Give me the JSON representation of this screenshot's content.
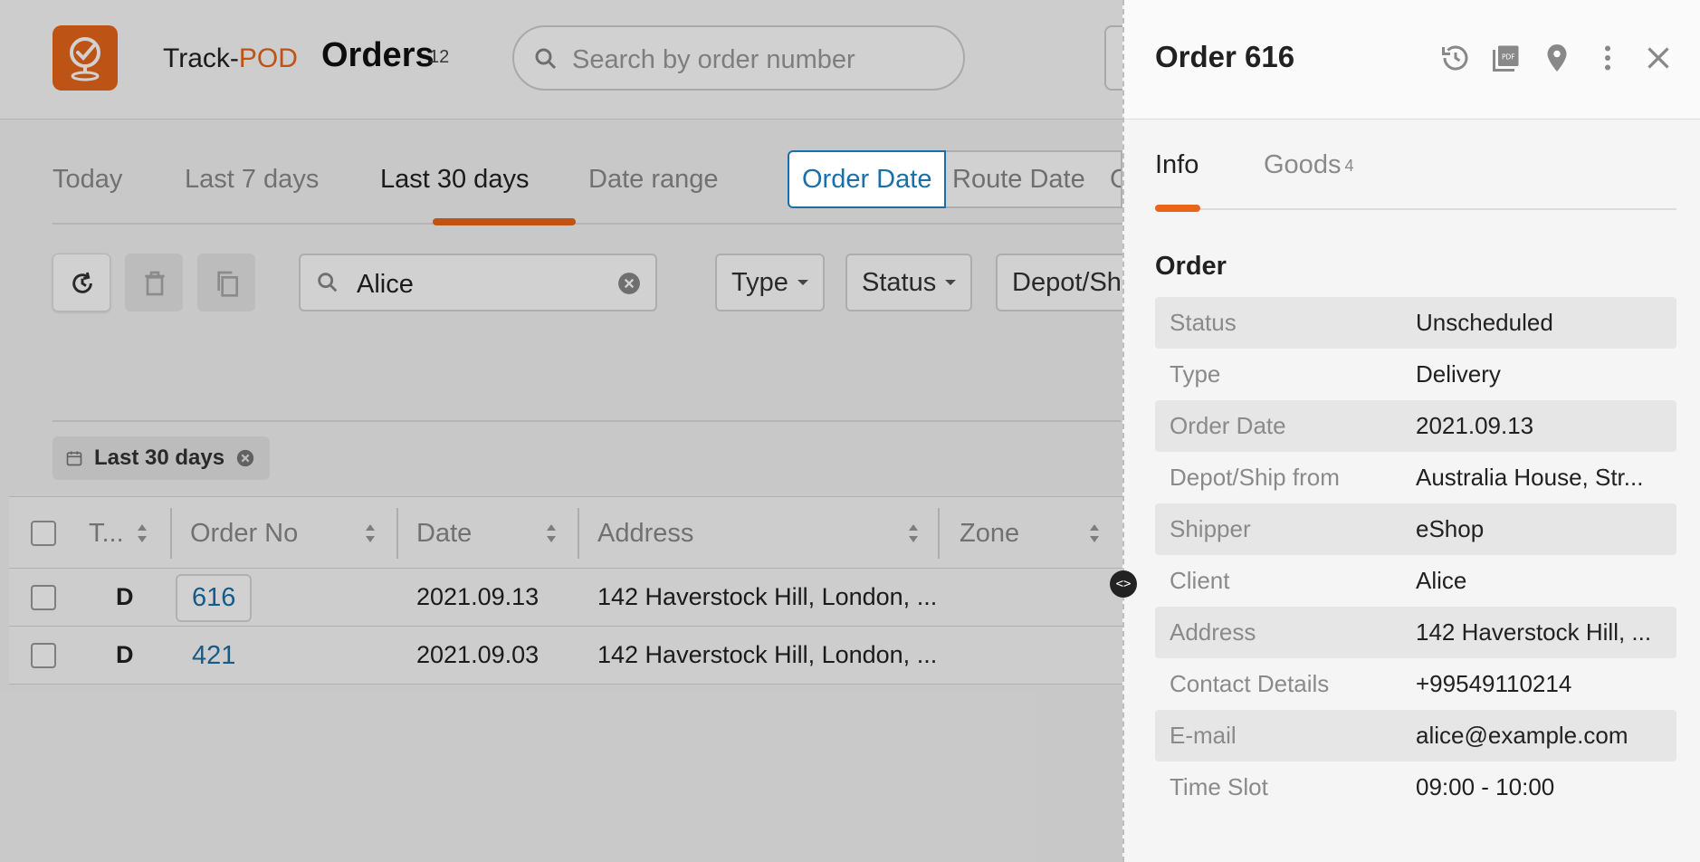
{
  "app": {
    "brand_left": "Track-",
    "brand_right": "POD",
    "page_title": "Orders",
    "order_count": "12"
  },
  "search": {
    "placeholder": "Search by order number"
  },
  "period_tabs": [
    {
      "label": "Today"
    },
    {
      "label": "Last 7 days"
    },
    {
      "label": "Last 30 days"
    },
    {
      "label": "Date range"
    }
  ],
  "date_mode": {
    "order_date": "Order Date",
    "route_date": "Route Date",
    "stub": "C"
  },
  "filters": {
    "search_value": "Alice",
    "type": "Type",
    "status": "Status",
    "depot": "Depot/Shi"
  },
  "active_chip": "Last 30 days",
  "grid": {
    "columns": [
      "T...",
      "Order No",
      "Date",
      "Address",
      "Zone"
    ],
    "rows": [
      {
        "type": "D",
        "order_no": "616",
        "date": "2021.09.13",
        "address": "142 Haverstock Hill, London, ..."
      },
      {
        "type": "D",
        "order_no": "421",
        "date": "2021.09.03",
        "address": "142 Haverstock Hill, London, ..."
      }
    ]
  },
  "resize_handle": "<>",
  "panel": {
    "title": "Order 616",
    "tabs": {
      "info": "Info",
      "goods": "Goods",
      "goods_count": "4"
    },
    "section": "Order",
    "fields": [
      {
        "key": "Status",
        "value": "Unscheduled"
      },
      {
        "key": "Type",
        "value": "Delivery"
      },
      {
        "key": "Order Date",
        "value": "2021.09.13"
      },
      {
        "key": "Depot/Ship from",
        "value": "Australia House, Str..."
      },
      {
        "key": "Shipper",
        "value": "eShop"
      },
      {
        "key": "Client",
        "value": "Alice"
      },
      {
        "key": "Address",
        "value": "142 Haverstock Hill, ..."
      },
      {
        "key": "Contact Details",
        "value": "+99549110214"
      },
      {
        "key": "E-mail",
        "value": "alice@example.com"
      },
      {
        "key": "Time Slot",
        "value": "09:00 - 10:00"
      }
    ],
    "icons": [
      "history-icon",
      "pdf-icon",
      "location-pin-icon",
      "more-vert-icon",
      "close-icon"
    ]
  },
  "colors": {
    "brand": "#e8661b",
    "link": "#1b6fa8"
  }
}
